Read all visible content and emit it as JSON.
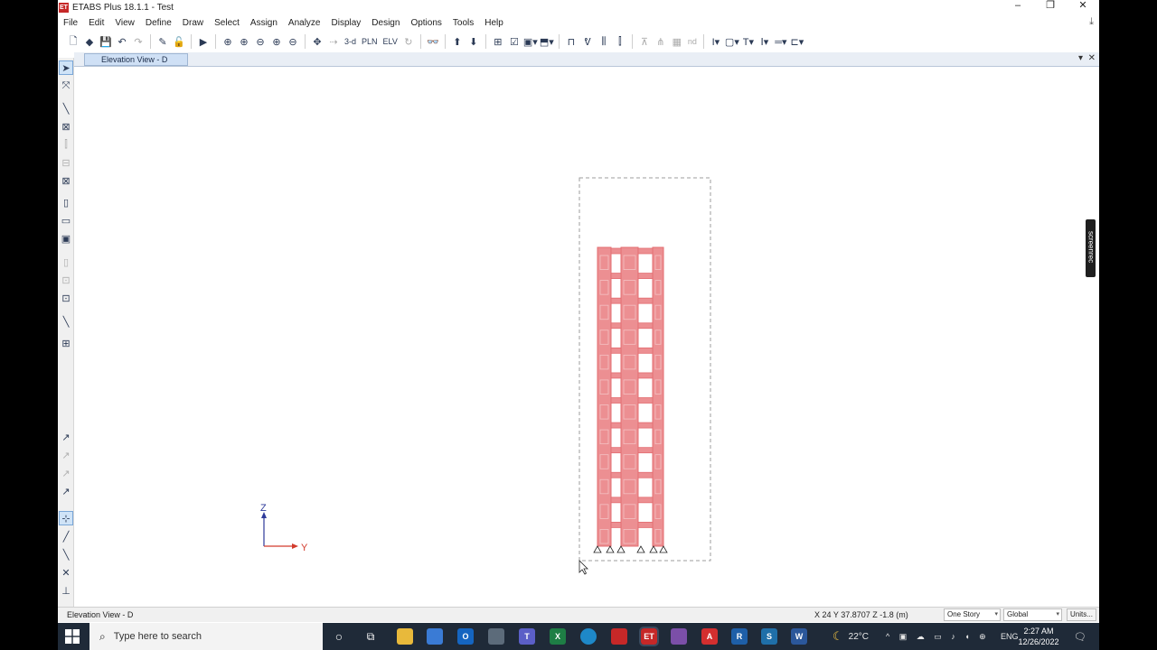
{
  "window": {
    "title": "ETABS Plus 18.1.1 - Test",
    "logo_text": "ET"
  },
  "menu": [
    "File",
    "Edit",
    "View",
    "Define",
    "Draw",
    "Select",
    "Assign",
    "Analyze",
    "Display",
    "Design",
    "Options",
    "Tools",
    "Help"
  ],
  "toolbar": {
    "view_3d_label": "3-d",
    "plan_label": "PLN",
    "elevation_label": "ELV",
    "nd_label": "nd"
  },
  "tab": {
    "label": "Elevation View - D"
  },
  "canvas": {
    "axis_z": "Z",
    "axis_y": "Y"
  },
  "status": {
    "view_label": "Elevation View - D",
    "coords": "X 24  Y 37.8707  Z -1.8 (m)",
    "story_select": "One Story",
    "coord_select": "Global",
    "units_button": "Units..."
  },
  "overlay": {
    "screenrec_label": "screenrec"
  },
  "taskbar": {
    "search_placeholder": "Type here to search",
    "temperature": "22°C",
    "language": "ENG",
    "time": "2:27 AM",
    "date": "12/26/2022"
  },
  "colors": {
    "frame_fill": "#ec8f92",
    "frame_stroke": "#e36c70",
    "axis_z": "#2d3a9a",
    "axis_y": "#d23a2c",
    "taskbar": "#1f2a38"
  }
}
